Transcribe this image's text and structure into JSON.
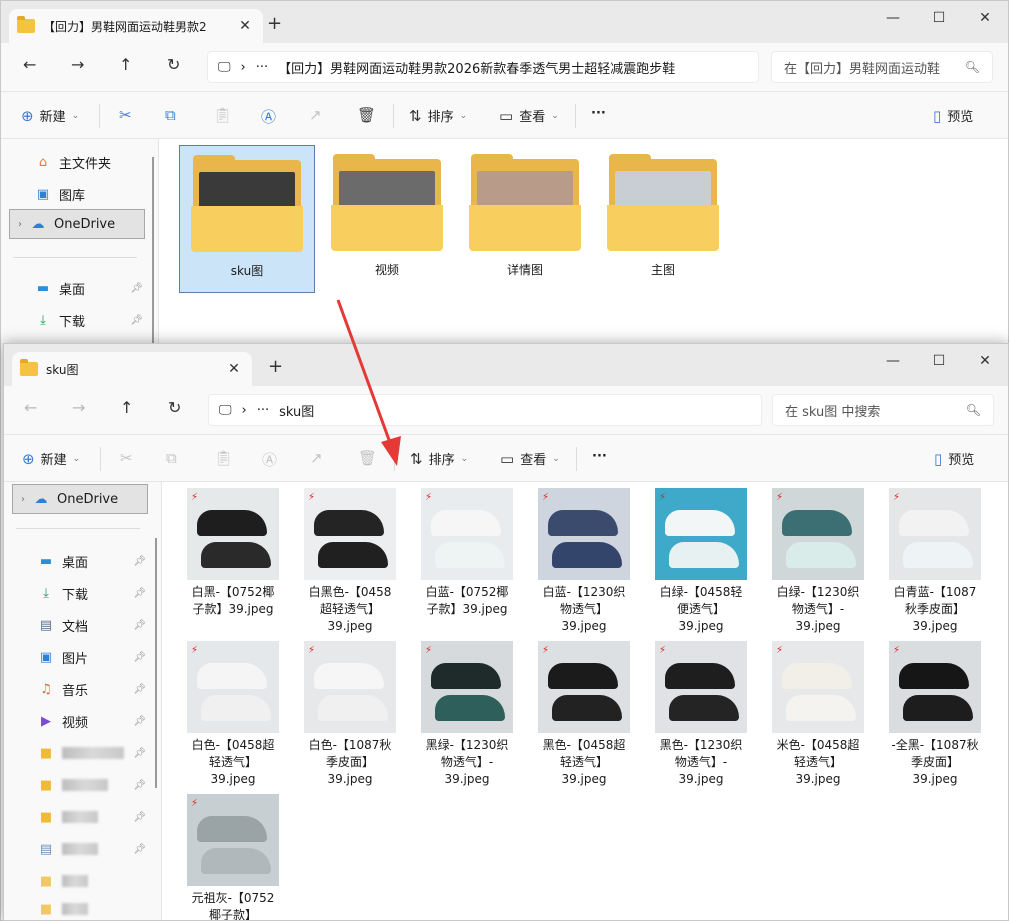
{
  "win1": {
    "tab_title": "【回力】男鞋网面运动鞋男款2",
    "path_text": "【回力】男鞋网面运动鞋男款2026新款春季透气男士超轻减震跑步鞋",
    "search_placeholder": "在【回力】男鞋网面运动鞋",
    "toolbar": {
      "new": "新建",
      "sort": "排序",
      "view": "查看",
      "more": "···",
      "preview": "预览"
    },
    "sidebar": [
      {
        "label": "主文件夹",
        "icon": "home-icon"
      },
      {
        "label": "图库",
        "icon": "gallery-icon"
      },
      {
        "label": "OneDrive",
        "icon": "cloud-icon"
      },
      {
        "label": "桌面",
        "icon": "desktop-icon"
      },
      {
        "label": "下载",
        "icon": "download-icon"
      }
    ],
    "folders": [
      {
        "label": "sku图",
        "pic": "#3a3a3a"
      },
      {
        "label": "视频",
        "pic": "#6b6b6b"
      },
      {
        "label": "详情图",
        "pic": "#b89b88"
      },
      {
        "label": "主图",
        "pic": "#c9ced4"
      }
    ]
  },
  "win2": {
    "tab_title": "sku图",
    "path_text": "sku图",
    "search_placeholder": "在 sku图 中搜索",
    "toolbar": {
      "new": "新建",
      "sort": "排序",
      "view": "查看",
      "more": "···",
      "preview": "预览"
    },
    "sidebar": [
      {
        "label": "OneDrive",
        "icon": "cloud-icon"
      },
      {
        "label": "桌面",
        "icon": "desktop-icon"
      },
      {
        "label": "下载",
        "icon": "download-icon"
      },
      {
        "label": "文档",
        "icon": "document-icon"
      },
      {
        "label": "图片",
        "icon": "pictures-icon"
      },
      {
        "label": "音乐",
        "icon": "music-icon"
      },
      {
        "label": "视频",
        "icon": "video-icon"
      }
    ],
    "files": [
      {
        "caption": [
          "白黑-【0752椰",
          "子款】39.jpeg"
        ],
        "bg": "#e6e9ea",
        "c1": "#1e1e1e",
        "c2": "#2a2a2a"
      },
      {
        "caption": [
          "白黑色-【0458",
          "超轻透气】",
          "39.jpeg"
        ],
        "bg": "#eceef0",
        "c1": "#242424",
        "c2": "#202020"
      },
      {
        "caption": [
          "白蓝-【0752椰",
          "子款】39.jpeg"
        ],
        "bg": "#e9ecee",
        "c1": "#f6f6f6",
        "c2": "#eef3f3"
      },
      {
        "caption": [
          "白蓝-【1230织",
          "物透气】",
          "39.jpeg"
        ],
        "bg": "#cfd5df",
        "c1": "#3b4b6e",
        "c2": "#33456a"
      },
      {
        "caption": [
          "白绿-【0458轻",
          "便透气】",
          "39.jpeg"
        ],
        "bg": "#3fa9c9",
        "c1": "#f3f6f6",
        "c2": "#e8f1f2"
      },
      {
        "caption": [
          "白绿-【1230织",
          "物透气】-",
          "39.jpeg"
        ],
        "bg": "#cfd7d8",
        "c1": "#3c6f73",
        "c2": "#d9ecea"
      },
      {
        "caption": [
          "白青蓝-【1087",
          "秋季皮面】",
          "39.jpeg"
        ],
        "bg": "#e4e6e8",
        "c1": "#f2f2f2",
        "c2": "#eef4f5"
      },
      {
        "caption": [
          "白色-【0458超",
          "轻透气】",
          "39.jpeg"
        ],
        "bg": "#e5e8ea",
        "c1": "#f5f5f5",
        "c2": "#f0f0f0"
      },
      {
        "caption": [
          "白色-【1087秋",
          "季皮面】",
          "39.jpeg"
        ],
        "bg": "#e6e8ea",
        "c1": "#f6f6f6",
        "c2": "#f0f0f0"
      },
      {
        "caption": [
          "黑绿-【1230织",
          "物透气】-",
          "39.jpeg"
        ],
        "bg": "#d6dadd",
        "c1": "#1f2b2b",
        "c2": "#2f5f5a"
      },
      {
        "caption": [
          "黑色-【0458超",
          "轻透气】",
          "39.jpeg"
        ],
        "bg": "#dde0e2",
        "c1": "#1b1b1b",
        "c2": "#222"
      },
      {
        "caption": [
          "黑色-【1230织",
          "物透气】-",
          "39.jpeg"
        ],
        "bg": "#e0e2e5",
        "c1": "#1e1e1e",
        "c2": "#242424"
      },
      {
        "caption": [
          "米色-【0458超",
          "轻透气】",
          "39.jpeg"
        ],
        "bg": "#e7e8ea",
        "c1": "#f2efe9",
        "c2": "#f5f3ef"
      },
      {
        "caption": [
          "-全黑-【1087秋",
          "季皮面】",
          "39.jpeg"
        ],
        "bg": "#dadde0",
        "c1": "#161616",
        "c2": "#1d1d1d"
      },
      {
        "caption": [
          "元祖灰-【0752",
          "椰子款】"
        ],
        "bg": "#c8cfd2",
        "c1": "#9aa3a6",
        "c2": "#b0b8bb"
      }
    ]
  }
}
